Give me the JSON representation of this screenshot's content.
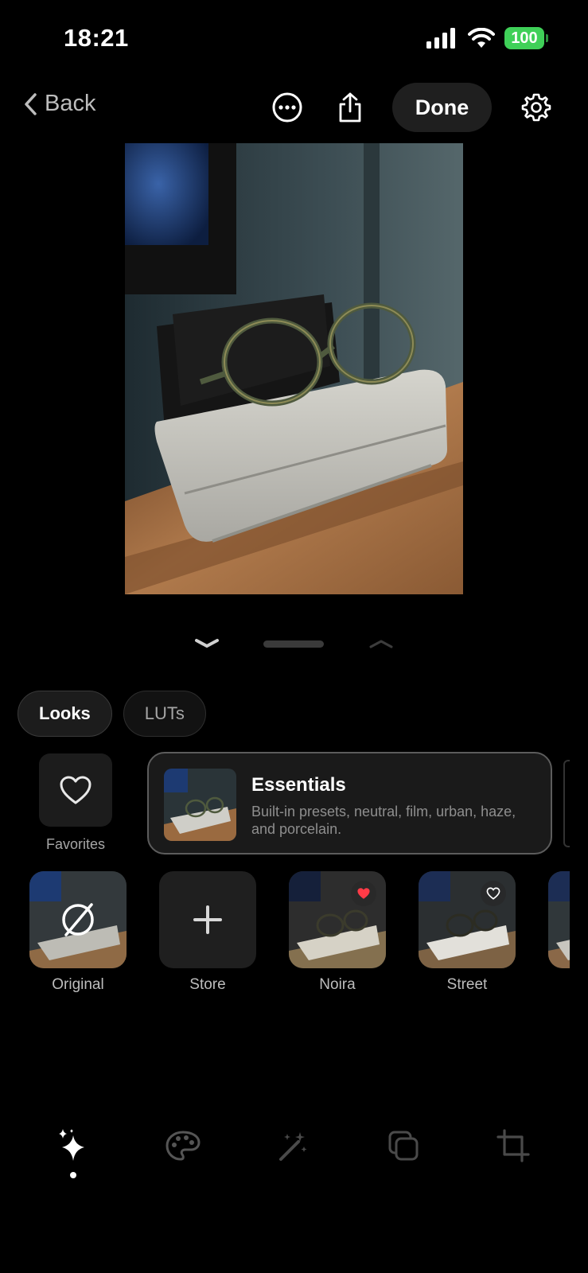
{
  "status_bar": {
    "time": "18:21",
    "battery": "100",
    "battery_color": "#3fd058"
  },
  "nav": {
    "back_label": "Back",
    "more_icon": "ellipsis-circle-icon",
    "share_icon": "share-icon",
    "done_label": "Done",
    "settings_icon": "gear-icon"
  },
  "tabs": [
    {
      "label": "Looks",
      "active": true
    },
    {
      "label": "LUTs",
      "active": false
    }
  ],
  "favorites": {
    "label": "Favorites",
    "icon": "heart-outline-icon"
  },
  "collection": {
    "title": "Essentials",
    "description": "Built-in presets, neutral, film, urban, haze, and porcelain."
  },
  "presets": [
    {
      "label": "Original",
      "icon": "no-filter-icon"
    },
    {
      "label": "Store",
      "icon": "plus-icon"
    },
    {
      "label": "Noira",
      "favorite": true,
      "favorite_color": "#ff3b47"
    },
    {
      "label": "Street",
      "favorite": false
    }
  ],
  "toolbar": [
    {
      "icon": "sparkles-icon",
      "active": true
    },
    {
      "icon": "palette-icon",
      "active": false
    },
    {
      "icon": "magic-wand-icon",
      "active": false
    },
    {
      "icon": "layers-icon",
      "active": false
    },
    {
      "icon": "crop-icon",
      "active": false
    }
  ]
}
